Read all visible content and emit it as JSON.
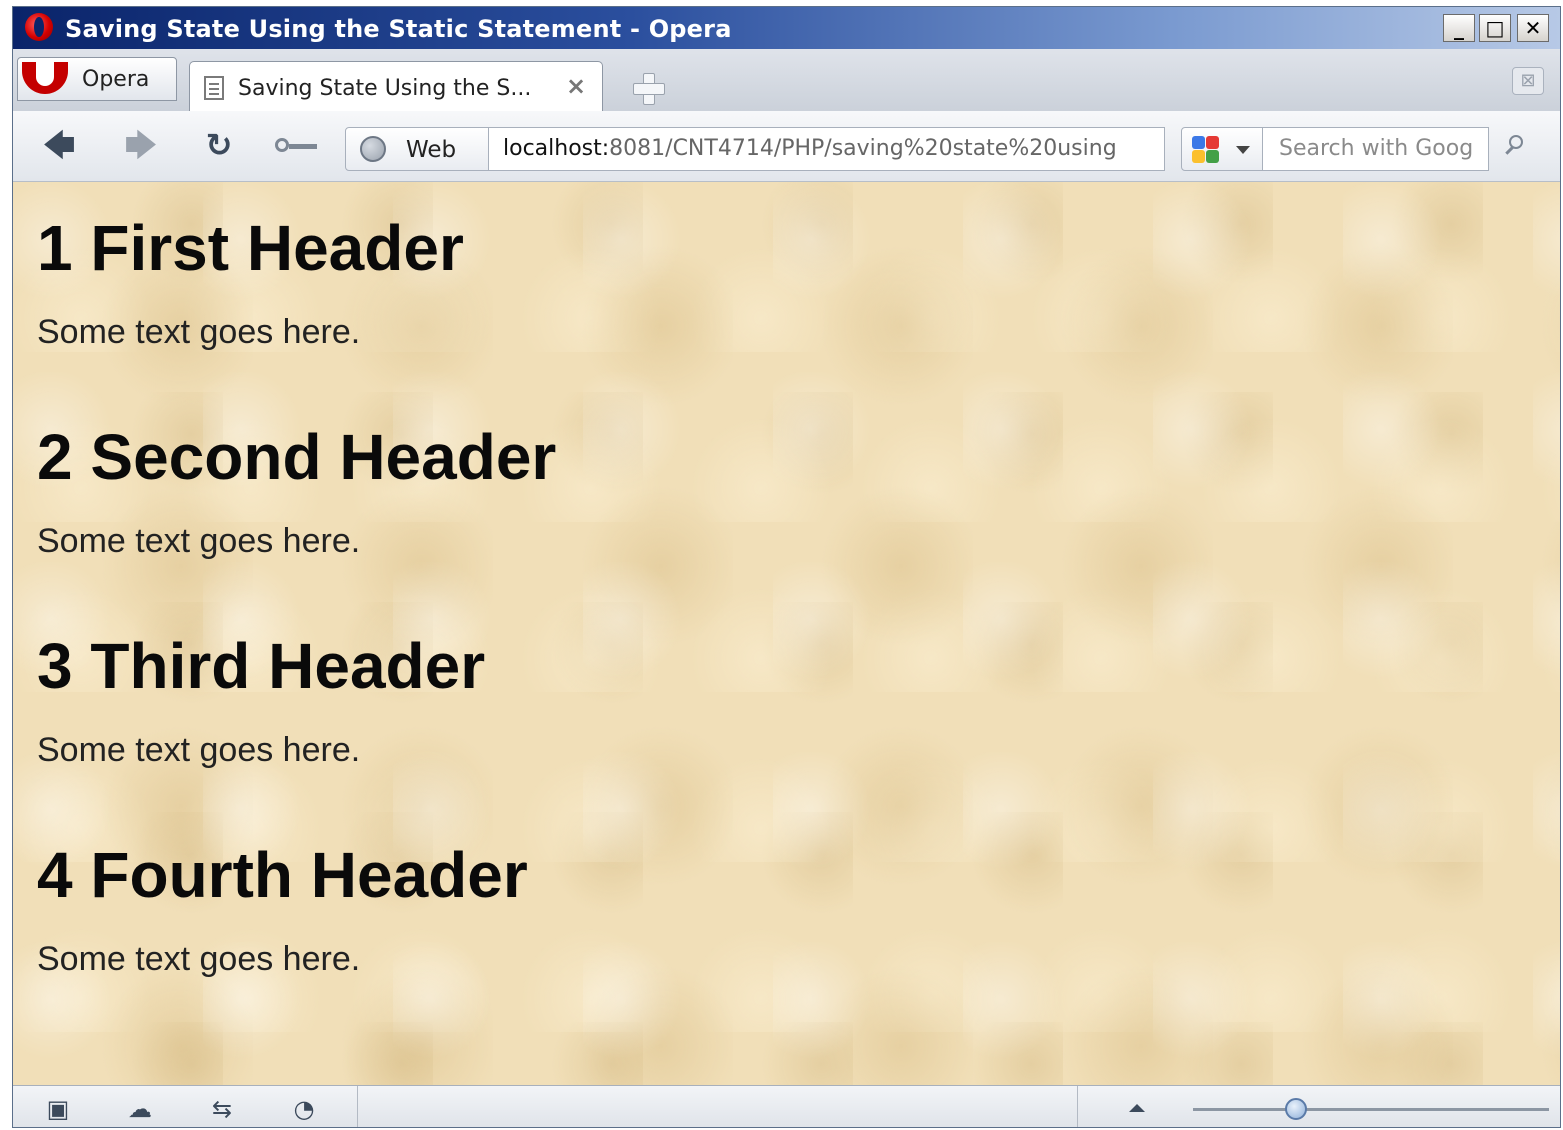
{
  "window": {
    "title": "Saving State Using the Static Statement - Opera",
    "controls": {
      "minimize": "_",
      "maximize": "□",
      "close": "✕"
    }
  },
  "tabs": {
    "menu_label": "Opera",
    "active_tab_label": "Saving State Using the S...",
    "close_glyph": "×",
    "closed_tabs_glyph": "⊠"
  },
  "toolbar": {
    "back_glyph": "🡄",
    "forward_glyph": "🡆",
    "reload_glyph": "↻",
    "site_badge_label": "Web",
    "address_host": "localhost:",
    "address_path": "8081/CNT4714/PHP/saving%20state%20using",
    "search_placeholder": "Search with Goog"
  },
  "page": {
    "sections": [
      {
        "heading": "1 First Header",
        "text": "Some text goes here."
      },
      {
        "heading": "2 Second Header",
        "text": "Some text goes here."
      },
      {
        "heading": "3 Third Header",
        "text": "Some text goes here."
      },
      {
        "heading": "4 Fourth Header",
        "text": "Some text goes here."
      }
    ]
  },
  "statusbar": {
    "panel_icon": "▣",
    "unite_icon": "☁",
    "share_icon": "⇆",
    "speed_icon": "◔",
    "zoom_fraction": 0.29
  },
  "colors": {
    "titlebar_start": "#0a246a",
    "content_background": "#f1dfb8",
    "opera_red": "#c40000"
  }
}
